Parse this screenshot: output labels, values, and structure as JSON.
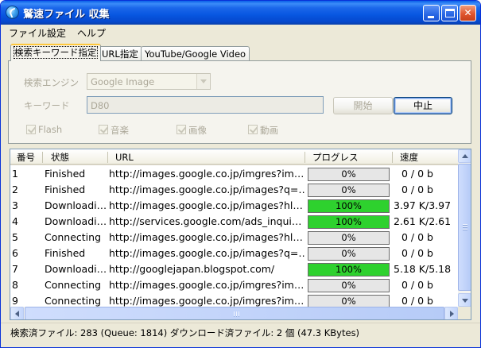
{
  "window": {
    "title": "鷲速ファイル 収集"
  },
  "menu": [
    "ファイル",
    "設定",
    "ヘルプ"
  ],
  "tabs": [
    "検索キーワード指定",
    "URL指定",
    "YouTube/Google Video"
  ],
  "search": {
    "engine_label": "検索エンジン",
    "engine_value": "Google Image",
    "keyword_label": "キーワード",
    "keyword_value": "D80",
    "start_button": "開始",
    "stop_button": "中止",
    "types": [
      "Flash",
      "音楽",
      "画像",
      "動画"
    ]
  },
  "table": {
    "columns": [
      "番号",
      "状態",
      "URL",
      "プログレス",
      "速度"
    ],
    "rows": [
      {
        "num": "1",
        "status": "Finished",
        "url": "http://images.google.co.jp/imgres?im…",
        "progress_text": "0%",
        "progress": 0,
        "speed": "0 /  0 b"
      },
      {
        "num": "2",
        "status": "Finished",
        "url": "http://images.google.co.jp/images?q=…",
        "progress_text": "0%",
        "progress": 0,
        "speed": "0 /  0 b"
      },
      {
        "num": "3",
        "status": "Downloadi…",
        "url": "http://images.google.co.jp/images?hl…",
        "progress_text": "100%",
        "progress": 100,
        "speed": "3.97 K/3.97"
      },
      {
        "num": "4",
        "status": "Downloadi…",
        "url": "http://services.google.com/ads_inqui…",
        "progress_text": "100%",
        "progress": 100,
        "speed": "2.61 K/2.61"
      },
      {
        "num": "5",
        "status": "Connecting",
        "url": "http://images.google.co.jp/images?hl…",
        "progress_text": "0%",
        "progress": 0,
        "speed": "0 /  0 b"
      },
      {
        "num": "6",
        "status": "Finished",
        "url": "http://images.google.co.jp/images?q=…",
        "progress_text": "0%",
        "progress": 0,
        "speed": "0 /  0 b"
      },
      {
        "num": "7",
        "status": "Downloadi…",
        "url": "http://googlejapan.blogspot.com/",
        "progress_text": "100%",
        "progress": 100,
        "speed": "5.18 K/5.18"
      },
      {
        "num": "8",
        "status": "Connecting",
        "url": "http://images.google.co.jp/imgres?im…",
        "progress_text": "0%",
        "progress": 0,
        "speed": "0 /  0 b"
      },
      {
        "num": "9",
        "status": "Connecting",
        "url": "http://images.google.co.jp/imgres?im…",
        "progress_text": "0%",
        "progress": 0,
        "speed": "0 /  0 b"
      }
    ]
  },
  "status_bar": "検索済ファイル: 283 (Queue: 1814)  ダウンロード済ファイル: 2 個 (47.3 KBytes)",
  "colors": {
    "titlebar": "#0756e0",
    "progress_fill": "#2ed12e",
    "tab_highlight": "#ffc83c"
  }
}
